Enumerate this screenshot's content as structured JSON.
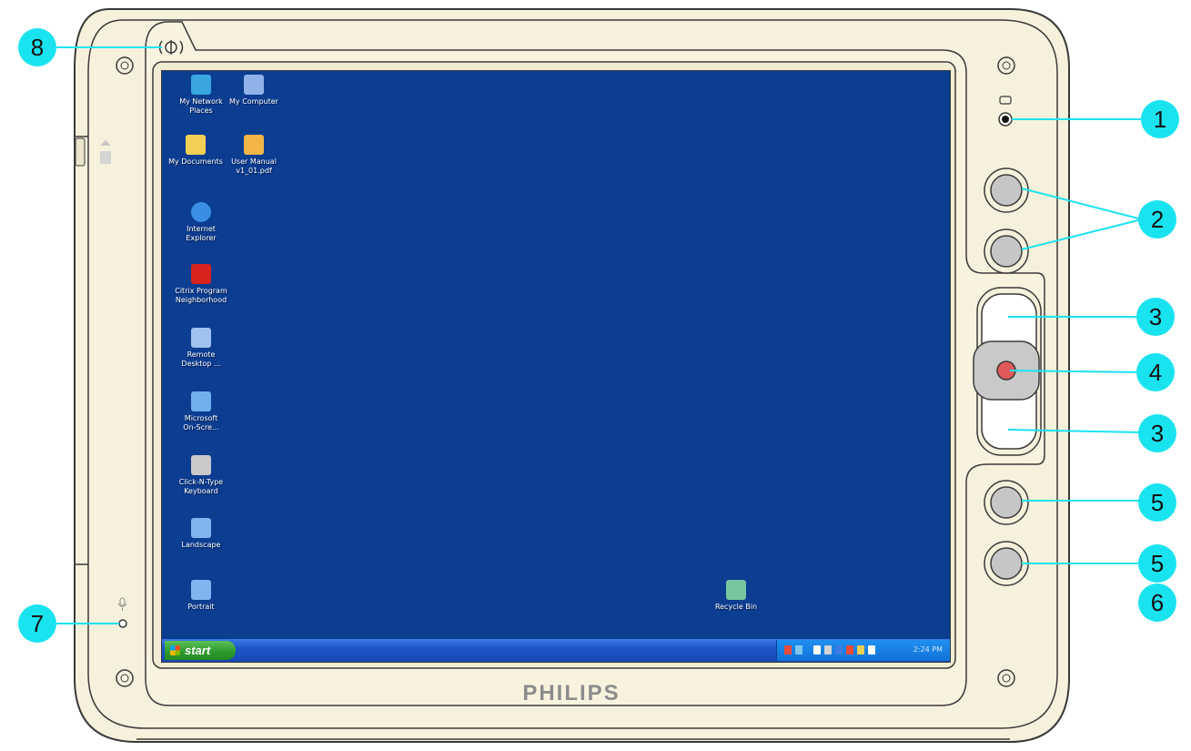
{
  "device": {
    "brand": "PHILIPS",
    "colors": {
      "bezel": "#f4efd9",
      "outline": "#3a3a3a",
      "callout": "#1ae3f0",
      "desktop": "#0b3d91",
      "select_button": "#e05a5a"
    }
  },
  "desktop": {
    "icons": [
      {
        "line1": "My Network",
        "line2": "Places",
        "icon": "network-places-icon",
        "color": "#39a6e0"
      },
      {
        "line1": "My Computer",
        "line2": "",
        "icon": "my-computer-icon",
        "color": "#8fb2e8"
      },
      {
        "line1": "My Documents",
        "line2": "",
        "icon": "my-documents-icon",
        "color": "#f2cf55"
      },
      {
        "line1": "User Manual",
        "line2": "v1_01.pdf",
        "icon": "pdf-document-icon",
        "color": "#f4b548"
      },
      {
        "line1": "Internet",
        "line2": "Explorer",
        "icon": "internet-explorer-icon",
        "color": "#3a8ee6"
      },
      {
        "line1": "Citrix Program",
        "line2": "Neighborhood",
        "icon": "citrix-icon",
        "color": "#d8231e"
      },
      {
        "line1": "Remote",
        "line2": "Desktop ...",
        "icon": "remote-desktop-icon",
        "color": "#9fc3ee"
      },
      {
        "line1": "Microsoft",
        "line2": "On-Scre...",
        "icon": "on-screen-keyboard-icon",
        "color": "#6fb0ea"
      },
      {
        "line1": "Click-N-Type",
        "line2": "Keyboard",
        "icon": "click-n-type-icon",
        "color": "#c9c9c9"
      },
      {
        "line1": "Landscape",
        "line2": "",
        "icon": "landscape-icon",
        "color": "#7fb6ef"
      },
      {
        "line1": "Portrait",
        "line2": "",
        "icon": "portrait-icon",
        "color": "#7fb6ef"
      },
      {
        "line1": "Recycle Bin",
        "line2": "",
        "icon": "recycle-bin-icon",
        "color": "#77c6a0"
      }
    ],
    "taskbar": {
      "start_label": "start",
      "clock": "2:24 PM"
    }
  },
  "callouts": [
    "1",
    "2",
    "3",
    "4",
    "3",
    "5",
    "5",
    "6",
    "7",
    "8"
  ]
}
